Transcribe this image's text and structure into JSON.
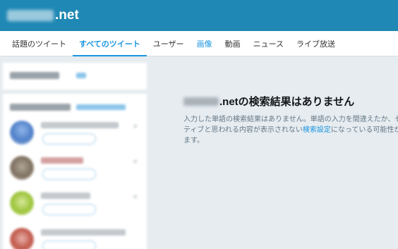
{
  "header": {
    "domain_suffix": ".net",
    "background_color": "#1f88b4"
  },
  "tabs": [
    {
      "label": "話題のツイート",
      "active": false
    },
    {
      "label": "すべてのツイート",
      "active": true
    },
    {
      "label": "ユーザー",
      "active": false
    },
    {
      "label": "画像",
      "active": false
    },
    {
      "label": "動画",
      "active": false
    },
    {
      "label": "ニュース",
      "active": false
    },
    {
      "label": "ライブ放送",
      "active": false
    }
  ],
  "main": {
    "title_suffix": ".netの検索結果はありません",
    "desc_line1": "入力した単語の検索結果はありません。単語の入力を間違えたか、セ",
    "desc_line2_before": "ティブと思われる内容が表示されない",
    "desc_line2_link": "検索設定",
    "desc_line2_after": "になっている可能性が",
    "desc_line3": "ます。"
  },
  "colors": {
    "accent": "#1b95e0",
    "page_background": "#e6ecf0"
  }
}
